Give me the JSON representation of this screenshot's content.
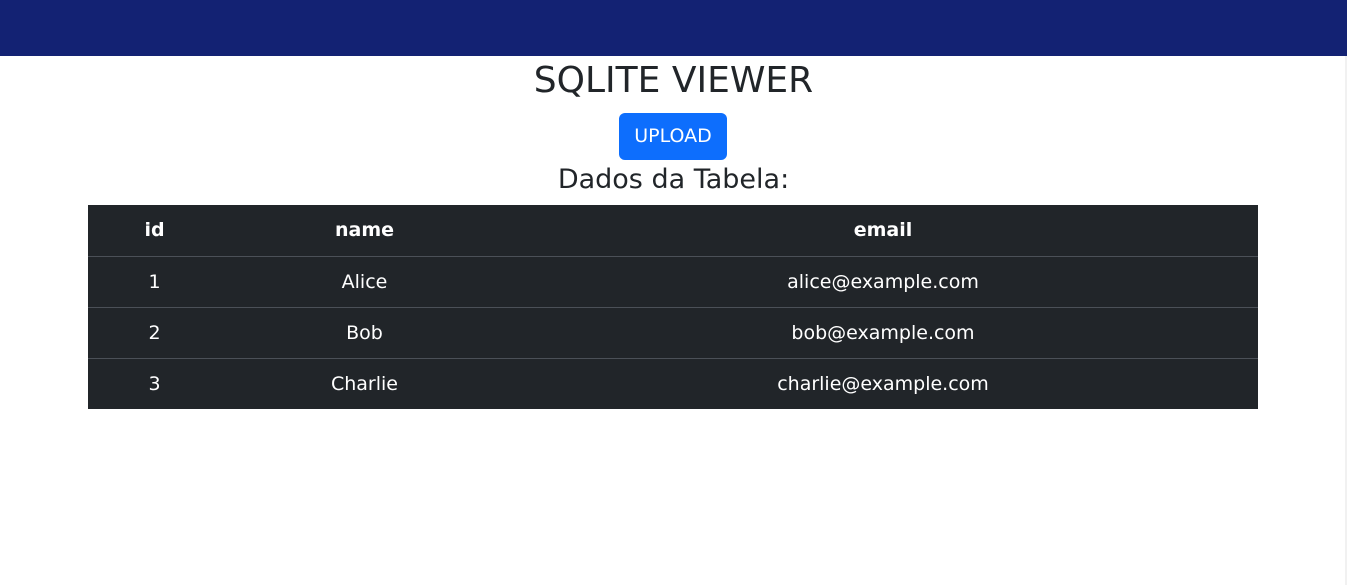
{
  "page": {
    "title": "SQLITE VIEWER",
    "upload_label": "UPLOAD",
    "section_title": "Dados da Tabela:"
  },
  "colors": {
    "topbar": "#132273",
    "button": "#0d6efd",
    "table_bg": "#212529"
  },
  "table": {
    "columns": [
      "id",
      "name",
      "email"
    ],
    "rows": [
      [
        "1",
        "Alice",
        "alice@example.com"
      ],
      [
        "2",
        "Bob",
        "bob@example.com"
      ],
      [
        "3",
        "Charlie",
        "charlie@example.com"
      ]
    ]
  }
}
